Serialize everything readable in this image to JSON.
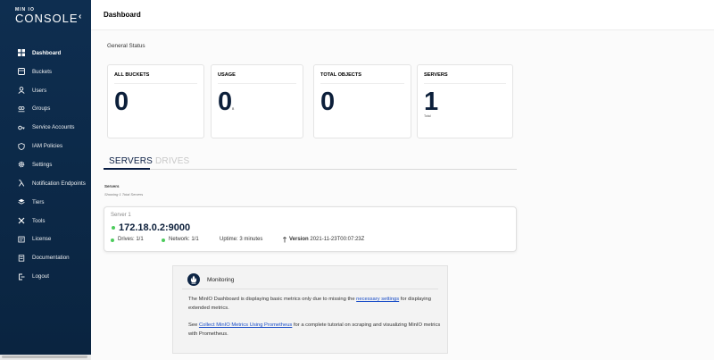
{
  "brand": {
    "min": "MIN IO",
    "console": "CONSOLE"
  },
  "sidebar": {
    "items": [
      {
        "label": "Dashboard",
        "icon": "dashboard-icon",
        "active": true
      },
      {
        "label": "Buckets",
        "icon": "bucket-icon"
      },
      {
        "label": "Users",
        "icon": "user-icon"
      },
      {
        "label": "Groups",
        "icon": "group-icon"
      },
      {
        "label": "Service Accounts",
        "icon": "key-icon"
      },
      {
        "label": "IAM Policies",
        "icon": "shield-icon"
      },
      {
        "label": "Settings",
        "icon": "gear-icon"
      },
      {
        "label": "Notification Endpoints",
        "icon": "lambda-icon"
      },
      {
        "label": "Tiers",
        "icon": "layers-icon"
      },
      {
        "label": "Tools",
        "icon": "tools-icon"
      },
      {
        "label": "License",
        "icon": "license-icon"
      },
      {
        "label": "Documentation",
        "icon": "book-icon"
      },
      {
        "label": "Logout",
        "icon": "logout-icon"
      }
    ]
  },
  "header": {
    "title": "Dashboard"
  },
  "general_status": "General Status",
  "cards": [
    {
      "label": "ALL BUCKETS",
      "value": "0"
    },
    {
      "label": "USAGE",
      "value": "0",
      "unit": "B"
    },
    {
      "label": "TOTAL OBJECTS",
      "value": "0"
    },
    {
      "label": "SERVERS",
      "value": "1",
      "sub": "Total"
    }
  ],
  "tabs": {
    "servers": "SERVERS",
    "drives": "DRIVES"
  },
  "servers": {
    "heading": "Servers",
    "subheading": "Showing 1 Total Servers",
    "card": {
      "name": "Server 1",
      "ip": "172.18.0.2:9000",
      "drives": "Drives: 1/1",
      "network": "Network: 1/1",
      "uptime": "Uptime: 3 minutes",
      "version_label": "Version",
      "version_value": "2021-11-23T00:07:23Z",
      "status_color": "#4ccb5c"
    }
  },
  "monitoring": {
    "title": "Monitoring",
    "p1_before": "The MinIO Dashboard is displaying basic metrics only due to missing the ",
    "p1_link": "necessary settings",
    "p1_after": " for displaying extended metrics.",
    "p2_before": "See ",
    "p2_link": "Collect MinIO Metrics Using Prometheus",
    "p2_after": " for a complete tutorial on scraping and visualizing MinIO metrics with Prometheus."
  },
  "colors": {
    "sidebar": "#0c2a4a",
    "accent": "#081c42",
    "link": "#1a4ec8"
  }
}
